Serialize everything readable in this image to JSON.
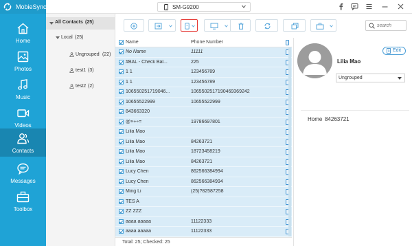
{
  "app": {
    "name": "MobieSync"
  },
  "device": {
    "name": "SM-G9200"
  },
  "window_controls": [
    "f",
    "chat",
    "menu",
    "minimize",
    "close"
  ],
  "nav": {
    "items": [
      {
        "label": "Home",
        "icon": "home-icon"
      },
      {
        "label": "Photos",
        "icon": "photo-icon"
      },
      {
        "label": "Music",
        "icon": "music-icon"
      },
      {
        "label": "Videos",
        "icon": "video-icon"
      },
      {
        "label": "Contacts",
        "icon": "contacts-icon",
        "active": true
      },
      {
        "label": "Messages",
        "icon": "messages-icon"
      },
      {
        "label": "Toolbox",
        "icon": "toolbox-icon"
      }
    ]
  },
  "groups": {
    "all": "All Contacts",
    "all_count": "(25)",
    "local": "Local",
    "local_count": "(25)",
    "children": [
      {
        "label": "Ungrouped",
        "count": "(22)"
      },
      {
        "label": "test1",
        "count": "(3)"
      },
      {
        "label": "test2",
        "count": "(2)"
      }
    ]
  },
  "toolbar": {
    "buttons": [
      "add-contact",
      "import",
      "export",
      "transfer-to-device",
      "delete",
      "refresh",
      "duplicate",
      "group"
    ],
    "search_placeholder": "search"
  },
  "table": {
    "col_name": "Name",
    "col_phone": "Phone Number",
    "rows": [
      {
        "name": "No Name",
        "phone": "11111",
        "italic": true
      },
      {
        "name": "#BAL - Check Bal...",
        "phone": "225"
      },
      {
        "name": "1 1",
        "phone": "123456789"
      },
      {
        "name": "1 1",
        "phone": "123456789"
      },
      {
        "name": "106550251719046...",
        "phone": "1065502517190469369242"
      },
      {
        "name": "10655522999",
        "phone": "10655522999"
      },
      {
        "name": "843663320",
        "phone": ""
      },
      {
        "name": "@×+÷=",
        "phone": "19786697801"
      },
      {
        "name": "Lilia Mao",
        "phone": ""
      },
      {
        "name": "Lilia Mao",
        "phone": "84263721"
      },
      {
        "name": "Lilia Mao",
        "phone": "18723458219"
      },
      {
        "name": "Lilia Mao",
        "phone": "84263721"
      },
      {
        "name": "Lucy Chen",
        "phone": "862566384994"
      },
      {
        "name": "Lucy Chen",
        "phone": "862566384994"
      },
      {
        "name": "Ming Li",
        "phone": "(25)?82587258"
      },
      {
        "name": "TES A",
        "phone": ""
      },
      {
        "name": "ZZ ZZZ",
        "phone": ""
      },
      {
        "name": "aaaa aaaaa",
        "phone": "11122333"
      },
      {
        "name": "aaaa aaaaa",
        "phone": "11122333"
      }
    ]
  },
  "footer": {
    "text": "Total: 25; Checked: 25"
  },
  "detail": {
    "name": "Lilia Mao",
    "edit_label": "Edit",
    "group_value": "Ungrouped",
    "phone_label": "Home",
    "phone_value": "84263721"
  },
  "colors": {
    "nav_bg": "#1fa3d6",
    "nav_active": "#1986b1",
    "row_selected": "#d9ecf8",
    "highlight_border": "#e53935"
  }
}
